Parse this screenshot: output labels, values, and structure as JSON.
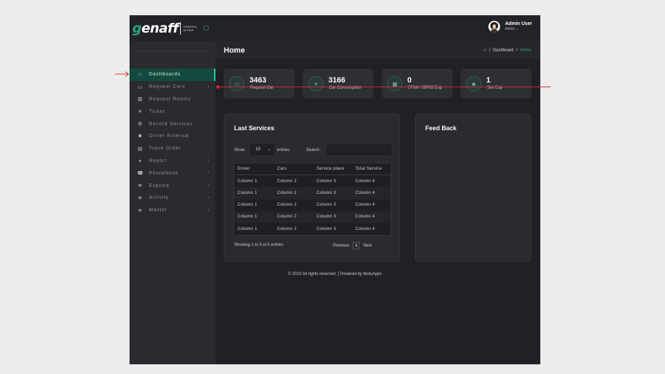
{
  "brand": {
    "logo_g": "g",
    "logo_rest": "enaff",
    "logo_sub_1": "GENERAL",
    "logo_sub_2": "AFFAIR"
  },
  "sidebar": {
    "items": [
      {
        "label": "Dashboards",
        "icon": "home-icon",
        "glyph": "⌂",
        "active": true,
        "chevron": false
      },
      {
        "label": "Request Cars",
        "icon": "car-icon",
        "glyph": "▭",
        "active": false,
        "chevron": true
      },
      {
        "label": "Request Rooms",
        "icon": "building-icon",
        "glyph": "▥",
        "active": false,
        "chevron": false
      },
      {
        "label": "Ticket",
        "icon": "plane-icon",
        "glyph": "✈",
        "active": false,
        "chevron": false
      },
      {
        "label": "Record Services",
        "icon": "gear-icon",
        "glyph": "⚙",
        "active": false,
        "chevron": false
      },
      {
        "label": "Driver External",
        "icon": "user-icon",
        "glyph": "☻",
        "active": false,
        "chevron": false
      },
      {
        "label": "Trace Order",
        "icon": "document-icon",
        "glyph": "▤",
        "active": false,
        "chevron": false
      },
      {
        "label": "Report",
        "icon": "globe-icon",
        "glyph": "◕",
        "active": false,
        "chevron": true
      },
      {
        "label": "Phonebook",
        "icon": "phone-icon",
        "glyph": "☎",
        "active": false,
        "chevron": true
      },
      {
        "label": "Expired",
        "icon": "database-icon",
        "glyph": "≋",
        "active": false,
        "chevron": true
      },
      {
        "label": "Activity",
        "icon": "database-icon",
        "glyph": "≋",
        "active": false,
        "chevron": true
      },
      {
        "label": "Master",
        "icon": "database-icon",
        "glyph": "≋",
        "active": false,
        "chevron": true
      }
    ]
  },
  "header": {
    "user_name": "Admin User",
    "user_role": "Admin ⌄"
  },
  "page": {
    "title": "Home",
    "breadcrumb": [
      "Dashboard",
      "Home"
    ]
  },
  "stats": [
    {
      "value": "3463",
      "label": "Request Car",
      "icon": "car-icon",
      "glyph": "▭"
    },
    {
      "value": "3166",
      "label": "Car Consumption",
      "icon": "fuel-icon",
      "glyph": "✕"
    },
    {
      "value": "0",
      "label": "STNK / BPKB Exp",
      "icon": "card-icon",
      "glyph": "▦"
    },
    {
      "value": "1",
      "label": "Sim Exp",
      "icon": "user-icon",
      "glyph": "☻"
    }
  ],
  "services": {
    "title": "Last Services",
    "show_label": "Show",
    "show_value": "10",
    "entries_label": "entries",
    "search_label": "Search :",
    "search_value": "",
    "columns": [
      "Driver",
      "Cars",
      "Service place",
      "Total Service"
    ],
    "rows": [
      [
        "Column 1",
        "Column 2",
        "Column 3",
        "Column 4"
      ],
      [
        "Column 1",
        "Column 2",
        "Column 3",
        "Column 4"
      ],
      [
        "Column 1",
        "Column 2",
        "Column 3",
        "Column 4"
      ],
      [
        "Column 1",
        "Column 2",
        "Column 3",
        "Column 4"
      ],
      [
        "Column 1",
        "Column 2",
        "Column 3",
        "Column 4"
      ]
    ],
    "info": "Showing 1 to 5 of 5 entries",
    "prev": "Previous",
    "page": "1",
    "next": "Next"
  },
  "feedback": {
    "title": "Feed Back"
  },
  "footer": {
    "copyright": "© 2023 All rights reserved. | Powered by MutuApps"
  },
  "colors": {
    "accent": "#2aa37f",
    "active_bg": "#134a3f",
    "annotation": "#d22a2a"
  }
}
